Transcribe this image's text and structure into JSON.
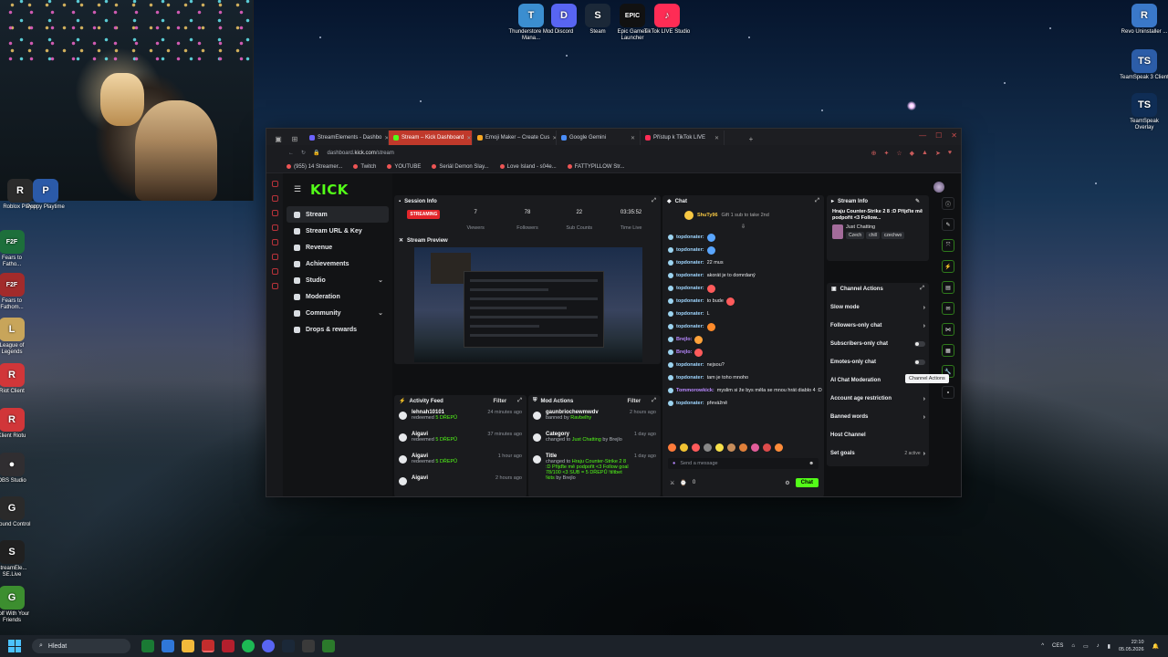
{
  "desktop": {
    "top_icons": [
      {
        "label": "Thunderstore Mod Mana...",
        "color": "#3b8ed0",
        "glyph": "T"
      },
      {
        "label": "Discord",
        "color": "#5865f2",
        "glyph": "D"
      },
      {
        "label": "Steam",
        "color": "#1b2838",
        "glyph": "S"
      },
      {
        "label": "Epic Games Launcher",
        "color": "#111111",
        "glyph": "EPIC"
      },
      {
        "label": "TikTok LIVE Studio",
        "color": "#fe2c55",
        "glyph": "♪"
      }
    ],
    "left_icons": [
      {
        "label": "Roblox Player",
        "color": "#2b2b2b",
        "glyph": "R"
      },
      {
        "label": "Poppy Playtime",
        "color": "#2b5aa8",
        "glyph": "P"
      },
      {
        "label": "Fears to Fatho...",
        "color": "#1d6f3b",
        "glyph": "F2F"
      },
      {
        "label": "Fears to Fathom...",
        "color": "#a22b2b",
        "glyph": "F2F"
      },
      {
        "label": "League of Legends",
        "color": "#c8a55a",
        "glyph": "L"
      },
      {
        "label": "Riot Client",
        "color": "#d13639",
        "glyph": "R"
      },
      {
        "label": "Klient Riotu",
        "color": "#d13639",
        "glyph": "R"
      },
      {
        "label": "OBS Studio",
        "color": "#302e31",
        "glyph": "●"
      },
      {
        "label": "Ground Control",
        "color": "#2a2a2a",
        "glyph": "G"
      },
      {
        "label": "StreamEle... SE.Live",
        "color": "#202020",
        "glyph": "S"
      },
      {
        "label": "Golf With Your Friends",
        "color": "#3c8e2f",
        "glyph": "G"
      }
    ],
    "right_icons": [
      {
        "label": "Revo Uninstaller ...",
        "color": "#3a78c9",
        "glyph": "R"
      },
      {
        "label": "TeamSpeak 3 Client",
        "color": "#2c5da8",
        "glyph": "TS"
      },
      {
        "label": "TeamSpeak Overlay",
        "color": "#0f2d55",
        "glyph": "TS"
      }
    ]
  },
  "browser": {
    "tabs": [
      {
        "label": "StreamElements - Dashbo",
        "color": "#6c63ff"
      },
      {
        "label": "Stream – Kick Dashboard",
        "color": "#53fc18",
        "active": true
      },
      {
        "label": "Emoji Maker – Create Cus",
        "color": "#f5a623"
      },
      {
        "label": "Google Gemini",
        "color": "#4a8df8"
      },
      {
        "label": "Přístup k TikTok LIVE",
        "color": "#fe2c55"
      }
    ],
    "url_domain": "dashboard.",
    "url_host": "kick.com",
    "url_path": "/stream",
    "bookmarks": [
      "(955) 14 Streamer...",
      "Twitch",
      "YOUTUBE",
      "Seriál Demon Slay...",
      "Love Island - s04e...",
      "FATTYPILLOW Str..."
    ]
  },
  "kick": {
    "logo": "KICK",
    "nav": [
      {
        "label": "Stream",
        "active": true
      },
      {
        "label": "Stream URL & Key"
      },
      {
        "label": "Revenue"
      },
      {
        "label": "Achievements"
      },
      {
        "label": "Studio",
        "chevron": true
      },
      {
        "label": "Moderation"
      },
      {
        "label": "Community",
        "chevron": true
      },
      {
        "label": "Drops & rewards"
      }
    ],
    "session": {
      "title": "Session Info",
      "live_label": "STREAMING",
      "stats": [
        {
          "value": "7",
          "label": "Viewers"
        },
        {
          "value": "78",
          "label": "Followers"
        },
        {
          "value": "22",
          "label": "Sub Counts"
        },
        {
          "value": "03:35:52",
          "label": "Time Live"
        }
      ],
      "preview_title": "Stream Preview"
    },
    "activity": {
      "title": "Activity Feed",
      "filter": "Filter",
      "items": [
        {
          "name": "lehnah10101",
          "action": "redeemed",
          "reward": "5 DŘEPŮ",
          "time": "24 minutes ago"
        },
        {
          "name": "Aigavi",
          "action": "redeemed",
          "reward": "5 DŘEPŮ",
          "time": "37 minutes ago"
        },
        {
          "name": "Aigavi",
          "action": "redeemed",
          "reward": "5 DŘEPŮ",
          "time": "1 hour ago"
        },
        {
          "name": "Aigavi",
          "action": "",
          "reward": "",
          "time": "2 hours ago"
        }
      ]
    },
    "mod_actions": {
      "title": "Mod Actions",
      "filter": "Filter",
      "items": [
        {
          "name": "gaunbriochewmwdv",
          "detail": "banned by",
          "by": "Ravbelhy",
          "time": "2 hours ago"
        },
        {
          "name": "Category",
          "detail": "changed to",
          "by": "Just Chatting",
          "extra": "by Brejlo",
          "time": "1 day ago"
        },
        {
          "name": "Title",
          "detail": "changed to",
          "by": "Hraju Counter-Strike 2 8 :D Přijďte mě podpořit <3 Follow goal 78/100 <3 SUB = 5 DŘEPŮ !tiltbet !kits",
          "extra": "by Brejlo",
          "time": "1 day ago"
        }
      ]
    },
    "chat": {
      "title": "Chat",
      "pinned_user": "ShuTy96",
      "pinned_text": "Gift 1 sub to take 2nd",
      "messages": [
        {
          "user": "topdonater:",
          "text": "",
          "emote": "#5aa6ff"
        },
        {
          "user": "topdonater:",
          "text": "",
          "emote": "#5aa6ff"
        },
        {
          "user": "topdonater:",
          "text": "22 mus",
          "emote": ""
        },
        {
          "user": "topdonater:",
          "text": "akorát je to domrdaný",
          "emote": ""
        },
        {
          "user": "topdonater:",
          "text": "",
          "emote": "#ff5b5b"
        },
        {
          "user": "topdonater:",
          "text": "to bude",
          "emote": "#ff5b5b"
        },
        {
          "user": "topdonater:",
          "text": "L",
          "emote": ""
        },
        {
          "user": "topdonater:",
          "text": "",
          "emote": "#ff8a2a"
        },
        {
          "user": "Brejlo:",
          "text": "",
          "emote": "#ffa23a",
          "purple": true
        },
        {
          "user": "Brejlo:",
          "text": "",
          "emote": "#ff5b5b",
          "purple": true
        },
        {
          "user": "topdonater:",
          "text": "nejsou?",
          "emote": ""
        },
        {
          "user": "topdonater:",
          "text": "tam je toho mnoho",
          "emote": ""
        },
        {
          "user": "Tommorowkick:",
          "text": "myslim si že bys měla se mnou hrát diablo 4 :D",
          "emote": "",
          "purple": true
        },
        {
          "user": "topdonater:",
          "text": "převážně",
          "emote": ""
        }
      ],
      "input_placeholder": "Send a message",
      "send_label": "Chat",
      "count": "0"
    },
    "stream_info": {
      "title": "Stream Info",
      "stream_title": "Hraju Counter-Strike 2 8 :D Přijďte mě podpořit <3 Follow...",
      "category": "Just Chatting",
      "tags": [
        "Czech",
        "chill",
        "czechwo"
      ]
    },
    "channel_actions": {
      "title": "Channel Actions",
      "items": [
        {
          "label": "Slow mode",
          "type": "arrow"
        },
        {
          "label": "Followers-only chat",
          "type": "arrow"
        },
        {
          "label": "Subscribers-only chat",
          "type": "toggle"
        },
        {
          "label": "Emotes-only chat",
          "type": "toggle"
        },
        {
          "label": "AI Chat Moderation",
          "type": "none"
        },
        {
          "label": "Account age restriction",
          "type": "arrow"
        },
        {
          "label": "Banned words",
          "type": "arrow"
        },
        {
          "label": "Host Channel",
          "type": "none"
        },
        {
          "label": "Set goals",
          "type": "arrow",
          "extra": "2 active"
        }
      ],
      "tooltip": "Channel Actions"
    }
  },
  "taskbar": {
    "search_placeholder": "Hledat",
    "lang": "CES",
    "time": "22:10",
    "date": "05.05.2026"
  }
}
